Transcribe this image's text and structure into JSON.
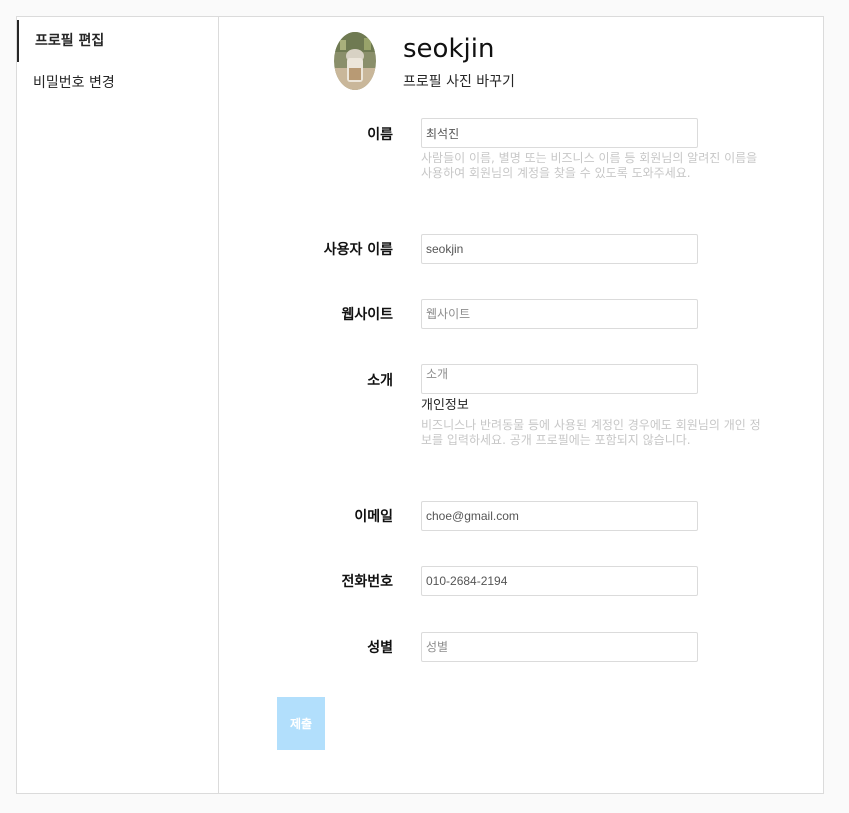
{
  "sidebar": {
    "items": [
      {
        "label": "프로필 편집",
        "active": true
      },
      {
        "label": "비밀번호 변경",
        "active": false
      }
    ]
  },
  "profile": {
    "username": "seokjin",
    "change_photo_label": "프로필 사진 바꾸기"
  },
  "form": {
    "name": {
      "label": "이름",
      "value": "최석진",
      "help": "사람들이 이름, 별명 또는 비즈니스 이름 등 회원님의 알려진 이름을 사용하여 회원님의 계정을 찾을 수 있도록 도와주세요."
    },
    "username": {
      "label": "사용자 이름",
      "value": "seokjin"
    },
    "website": {
      "label": "웹사이트",
      "placeholder": "웹사이트"
    },
    "bio": {
      "label": "소개",
      "placeholder": "소개"
    },
    "personal_info": {
      "title": "개인정보",
      "help": "비즈니스나 반려동물 등에 사용된 계정인 경우에도 회원님의 개인 정보를 입력하세요. 공개 프로필에는 포함되지 않습니다."
    },
    "email": {
      "label": "이메일",
      "value": "choe@gmail.com"
    },
    "phone": {
      "label": "전화번호",
      "value": "010-2684-2194"
    },
    "gender": {
      "label": "성별",
      "placeholder": "성별"
    },
    "submit_label": "제출"
  },
  "colors": {
    "submit_disabled_bg": "#b2dffc",
    "border": "#dbdbdb",
    "help_text": "#c7c7c7"
  }
}
